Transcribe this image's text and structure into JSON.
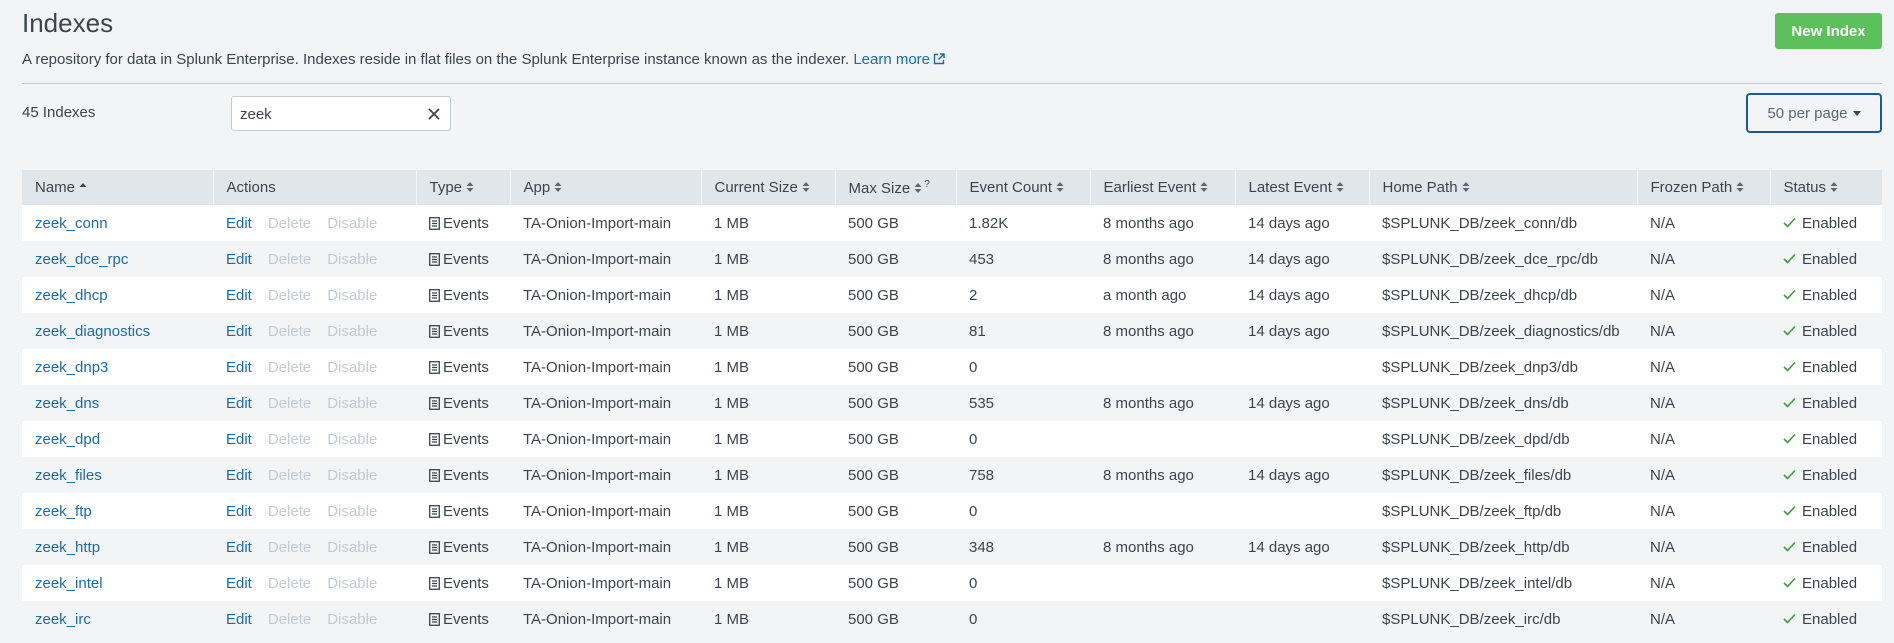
{
  "header": {
    "title": "Indexes",
    "description": "A repository for data in Splunk Enterprise. Indexes reside in flat files on the Splunk Enterprise instance known as the indexer.",
    "learn_more": "Learn more",
    "new_index_label": "New Index"
  },
  "toolbar": {
    "count_label": "45 Indexes",
    "search_value": "zeek",
    "per_page_label": "50 per page"
  },
  "table": {
    "columns": [
      "Name",
      "Actions",
      "Type",
      "App",
      "Current Size",
      "Max Size",
      "Event Count",
      "Earliest Event",
      "Latest Event",
      "Home Path",
      "Frozen Path",
      "Status"
    ],
    "max_size_help": "?",
    "actions": {
      "edit": "Edit",
      "delete": "Delete",
      "disable": "Disable"
    },
    "rows": [
      {
        "name": "zeek_conn",
        "type": "Events",
        "app": "TA-Onion-Import-main",
        "current_size": "1 MB",
        "max_size": "500 GB",
        "event_count": "1.82K",
        "earliest": "8 months ago",
        "latest": "14 days ago",
        "home_path": "$SPLUNK_DB/zeek_conn/db",
        "frozen_path": "N/A",
        "status": "Enabled"
      },
      {
        "name": "zeek_dce_rpc",
        "type": "Events",
        "app": "TA-Onion-Import-main",
        "current_size": "1 MB",
        "max_size": "500 GB",
        "event_count": "453",
        "earliest": "8 months ago",
        "latest": "14 days ago",
        "home_path": "$SPLUNK_DB/zeek_dce_rpc/db",
        "frozen_path": "N/A",
        "status": "Enabled"
      },
      {
        "name": "zeek_dhcp",
        "type": "Events",
        "app": "TA-Onion-Import-main",
        "current_size": "1 MB",
        "max_size": "500 GB",
        "event_count": "2",
        "earliest": "a month ago",
        "latest": "14 days ago",
        "home_path": "$SPLUNK_DB/zeek_dhcp/db",
        "frozen_path": "N/A",
        "status": "Enabled"
      },
      {
        "name": "zeek_diagnostics",
        "type": "Events",
        "app": "TA-Onion-Import-main",
        "current_size": "1 MB",
        "max_size": "500 GB",
        "event_count": "81",
        "earliest": "8 months ago",
        "latest": "14 days ago",
        "home_path": "$SPLUNK_DB/zeek_diagnostics/db",
        "frozen_path": "N/A",
        "status": "Enabled"
      },
      {
        "name": "zeek_dnp3",
        "type": "Events",
        "app": "TA-Onion-Import-main",
        "current_size": "1 MB",
        "max_size": "500 GB",
        "event_count": "0",
        "earliest": "",
        "latest": "",
        "home_path": "$SPLUNK_DB/zeek_dnp3/db",
        "frozen_path": "N/A",
        "status": "Enabled"
      },
      {
        "name": "zeek_dns",
        "type": "Events",
        "app": "TA-Onion-Import-main",
        "current_size": "1 MB",
        "max_size": "500 GB",
        "event_count": "535",
        "earliest": "8 months ago",
        "latest": "14 days ago",
        "home_path": "$SPLUNK_DB/zeek_dns/db",
        "frozen_path": "N/A",
        "status": "Enabled"
      },
      {
        "name": "zeek_dpd",
        "type": "Events",
        "app": "TA-Onion-Import-main",
        "current_size": "1 MB",
        "max_size": "500 GB",
        "event_count": "0",
        "earliest": "",
        "latest": "",
        "home_path": "$SPLUNK_DB/zeek_dpd/db",
        "frozen_path": "N/A",
        "status": "Enabled"
      },
      {
        "name": "zeek_files",
        "type": "Events",
        "app": "TA-Onion-Import-main",
        "current_size": "1 MB",
        "max_size": "500 GB",
        "event_count": "758",
        "earliest": "8 months ago",
        "latest": "14 days ago",
        "home_path": "$SPLUNK_DB/zeek_files/db",
        "frozen_path": "N/A",
        "status": "Enabled"
      },
      {
        "name": "zeek_ftp",
        "type": "Events",
        "app": "TA-Onion-Import-main",
        "current_size": "1 MB",
        "max_size": "500 GB",
        "event_count": "0",
        "earliest": "",
        "latest": "",
        "home_path": "$SPLUNK_DB/zeek_ftp/db",
        "frozen_path": "N/A",
        "status": "Enabled"
      },
      {
        "name": "zeek_http",
        "type": "Events",
        "app": "TA-Onion-Import-main",
        "current_size": "1 MB",
        "max_size": "500 GB",
        "event_count": "348",
        "earliest": "8 months ago",
        "latest": "14 days ago",
        "home_path": "$SPLUNK_DB/zeek_http/db",
        "frozen_path": "N/A",
        "status": "Enabled"
      },
      {
        "name": "zeek_intel",
        "type": "Events",
        "app": "TA-Onion-Import-main",
        "current_size": "1 MB",
        "max_size": "500 GB",
        "event_count": "0",
        "earliest": "",
        "latest": "",
        "home_path": "$SPLUNK_DB/zeek_intel/db",
        "frozen_path": "N/A",
        "status": "Enabled"
      },
      {
        "name": "zeek_irc",
        "type": "Events",
        "app": "TA-Onion-Import-main",
        "current_size": "1 MB",
        "max_size": "500 GB",
        "event_count": "0",
        "earliest": "",
        "latest": "",
        "home_path": "$SPLUNK_DB/zeek_irc/db",
        "frozen_path": "N/A",
        "status": "Enabled"
      }
    ]
  },
  "icons": {
    "external": "external-link-icon",
    "clear": "close-icon",
    "sort": "sort-icon",
    "type": "document-icon",
    "status": "checkmark-icon"
  },
  "colors": {
    "link": "#1a6ca8",
    "new_button": "#5cc05c",
    "status_check": "#3f9a3f",
    "header_bg": "#e1e6eb"
  }
}
